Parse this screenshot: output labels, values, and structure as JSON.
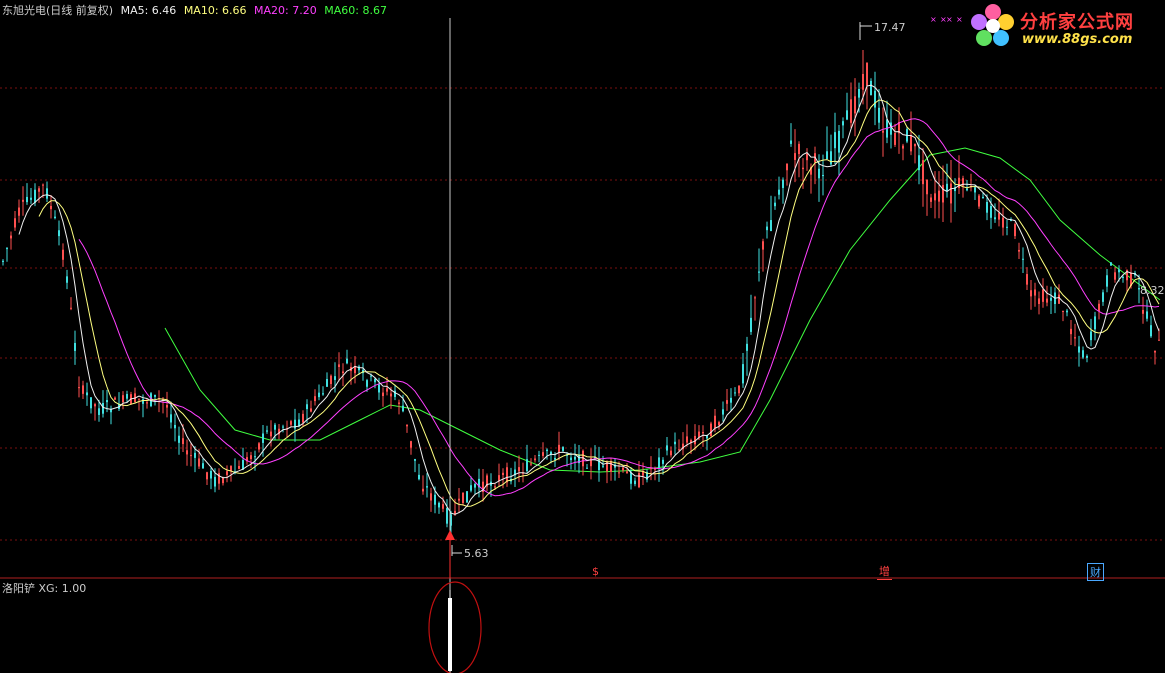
{
  "header": {
    "stock": "东旭光电(日线 前复权)",
    "ma5": "MA5: 6.46",
    "ma10": "MA10: 6.66",
    "ma20": "MA20: 7.20",
    "ma60": "MA60: 8.67"
  },
  "colors": {
    "ma5": "#f0f0f0",
    "ma10": "#ffff80",
    "ma20": "#ff40ff",
    "ma60": "#40ff40",
    "up": "#ff5050",
    "down": "#40e0e0",
    "grid": "#7a1010",
    "cursor": "#c8c8c8"
  },
  "sub_header": {
    "name": "洛阳铲",
    "xg": "XG: 1.00"
  },
  "markers": {
    "high": "17.47",
    "low": "5.63",
    "right_price": "8.32"
  },
  "badges": [
    {
      "text": "$",
      "color": "#ff4040"
    },
    {
      "text": "增",
      "color": "#ff4040"
    },
    {
      "text": "财",
      "color": "#4aa8ff"
    }
  ],
  "logo": {
    "title": "分析家公式网",
    "url": "www.88gs.com"
  },
  "chart_data": {
    "type": "line",
    "title": "东旭光电(日线 前复权)",
    "candles_visible": true,
    "y_range": [
      5.0,
      18.0
    ],
    "key_points": [
      {
        "label": "high",
        "value": 17.47
      },
      {
        "label": "low",
        "value": 5.63
      }
    ],
    "series": [
      {
        "name": "MA5",
        "last": 6.46
      },
      {
        "name": "MA10",
        "last": 6.66
      },
      {
        "name": "MA20",
        "last": 7.2
      },
      {
        "name": "MA60",
        "last": 8.67
      }
    ],
    "indicator": {
      "name": "洛阳铲",
      "name_label": "XG",
      "value": 1.0
    }
  }
}
